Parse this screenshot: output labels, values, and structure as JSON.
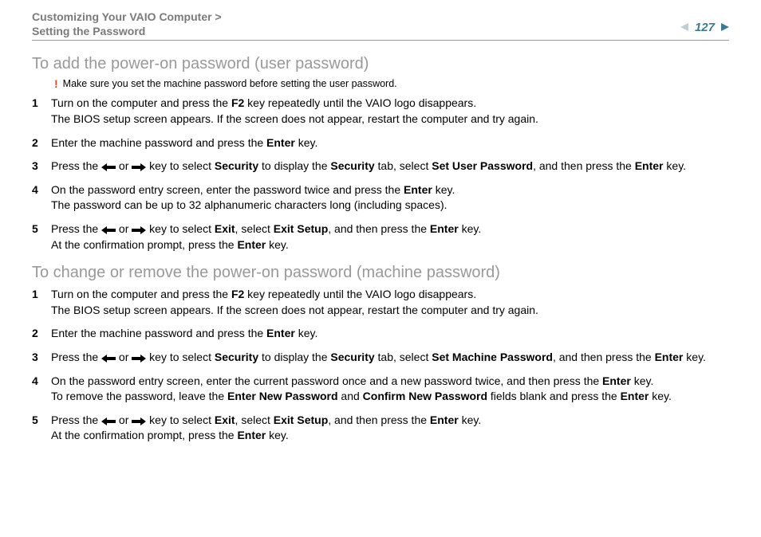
{
  "breadcrumb_line1": "Customizing Your VAIO Computer >",
  "breadcrumb_line2": "Setting the Password",
  "page_number": "127",
  "section1": {
    "heading": "To add the power-on password (user password)",
    "warning": "Make sure you set the machine password before setting the user password.",
    "steps": [
      {
        "n": "1",
        "parts": [
          [
            "",
            "Turn on the computer and press the "
          ],
          [
            "b",
            "F2"
          ],
          [
            "",
            " key repeatedly until the VAIO logo disappears."
          ],
          [
            "br",
            ""
          ],
          [
            "",
            "The BIOS setup screen appears. If the screen does not appear, restart the computer and try again."
          ]
        ]
      },
      {
        "n": "2",
        "parts": [
          [
            "",
            "Enter the machine password and press the "
          ],
          [
            "b",
            "Enter"
          ],
          [
            "",
            " key."
          ]
        ]
      },
      {
        "n": "3",
        "parts": [
          [
            "",
            "Press the "
          ],
          [
            "la",
            ""
          ],
          [
            "",
            " or "
          ],
          [
            "ra",
            ""
          ],
          [
            "",
            " key to select "
          ],
          [
            "b",
            "Security"
          ],
          [
            "",
            " to display the "
          ],
          [
            "b",
            "Security"
          ],
          [
            "",
            " tab, select "
          ],
          [
            "b",
            "Set User Password"
          ],
          [
            "",
            ", and then press the "
          ],
          [
            "b",
            "Enter"
          ],
          [
            "",
            " key."
          ]
        ]
      },
      {
        "n": "4",
        "parts": [
          [
            "",
            "On the password entry screen, enter the password twice and press the "
          ],
          [
            "b",
            "Enter"
          ],
          [
            "",
            " key."
          ],
          [
            "br",
            ""
          ],
          [
            "",
            "The password can be up to 32 alphanumeric characters long (including spaces)."
          ]
        ]
      },
      {
        "n": "5",
        "parts": [
          [
            "",
            "Press the "
          ],
          [
            "la",
            ""
          ],
          [
            "",
            " or "
          ],
          [
            "ra",
            ""
          ],
          [
            "",
            " key to select "
          ],
          [
            "b",
            "Exit"
          ],
          [
            "",
            ", select "
          ],
          [
            "b",
            "Exit Setup"
          ],
          [
            "",
            ", and then press the "
          ],
          [
            "b",
            "Enter"
          ],
          [
            "",
            " key."
          ],
          [
            "br",
            ""
          ],
          [
            "",
            "At the confirmation prompt, press the "
          ],
          [
            "b",
            "Enter"
          ],
          [
            "",
            " key."
          ]
        ]
      }
    ]
  },
  "section2": {
    "heading": "To change or remove the power-on password (machine password)",
    "steps": [
      {
        "n": "1",
        "parts": [
          [
            "",
            "Turn on the computer and press the "
          ],
          [
            "b",
            "F2"
          ],
          [
            "",
            " key repeatedly until the VAIO logo disappears."
          ],
          [
            "br",
            ""
          ],
          [
            "",
            "The BIOS setup screen appears. If the screen does not appear, restart the computer and try again."
          ]
        ]
      },
      {
        "n": "2",
        "parts": [
          [
            "",
            "Enter the machine password and press the "
          ],
          [
            "b",
            "Enter"
          ],
          [
            "",
            " key."
          ]
        ]
      },
      {
        "n": "3",
        "parts": [
          [
            "",
            "Press the "
          ],
          [
            "la",
            ""
          ],
          [
            "",
            " or "
          ],
          [
            "ra",
            ""
          ],
          [
            "",
            " key to select "
          ],
          [
            "b",
            "Security"
          ],
          [
            "",
            " to display the "
          ],
          [
            "b",
            "Security"
          ],
          [
            "",
            " tab, select "
          ],
          [
            "b",
            "Set Machine Password"
          ],
          [
            "",
            ", and then press the "
          ],
          [
            "b",
            "Enter"
          ],
          [
            "",
            " key."
          ]
        ]
      },
      {
        "n": "4",
        "parts": [
          [
            "",
            "On the password entry screen, enter the current password once and a new password twice, and then press the "
          ],
          [
            "b",
            "Enter"
          ],
          [
            "",
            " key."
          ],
          [
            "br",
            ""
          ],
          [
            "",
            "To remove the password, leave the "
          ],
          [
            "b",
            "Enter New Password"
          ],
          [
            "",
            " and "
          ],
          [
            "b",
            "Confirm New Password"
          ],
          [
            "",
            " fields blank and press the "
          ],
          [
            "b",
            "Enter"
          ],
          [
            "",
            " key."
          ]
        ]
      },
      {
        "n": "5",
        "parts": [
          [
            "",
            "Press the "
          ],
          [
            "la",
            ""
          ],
          [
            "",
            " or "
          ],
          [
            "ra",
            ""
          ],
          [
            "",
            " key to select "
          ],
          [
            "b",
            "Exit"
          ],
          [
            "",
            ", select "
          ],
          [
            "b",
            "Exit Setup"
          ],
          [
            "",
            ", and then press the "
          ],
          [
            "b",
            "Enter"
          ],
          [
            "",
            " key."
          ],
          [
            "br",
            ""
          ],
          [
            "",
            "At the confirmation prompt, press the "
          ],
          [
            "b",
            "Enter"
          ],
          [
            "",
            " key."
          ]
        ]
      }
    ]
  }
}
